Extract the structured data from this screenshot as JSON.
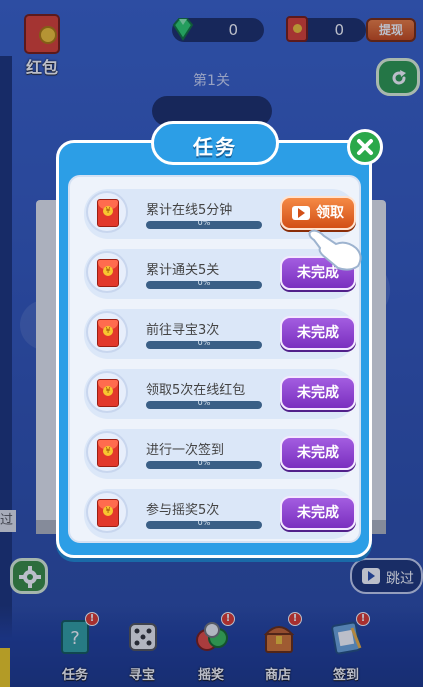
{
  "top_bar": {
    "hongbao_label": "红包",
    "gem_count": "0",
    "hongbao_count": "0",
    "withdraw_label": "提现"
  },
  "stage": {
    "label": "第1关"
  },
  "skip": {
    "label": "跳过"
  },
  "modal": {
    "title": "任务",
    "tasks": [
      {
        "name": "累计在线5分钟",
        "progress_text": "0%",
        "progress": 0,
        "button": "领取",
        "state": "claim"
      },
      {
        "name": "累计通关5关",
        "progress_text": "0%",
        "progress": 0,
        "button": "未完成",
        "state": "incomplete"
      },
      {
        "name": "前往寻宝3次",
        "progress_text": "0%",
        "progress": 0,
        "button": "未完成",
        "state": "incomplete"
      },
      {
        "name": "领取5次在线红包",
        "progress_text": "0%",
        "progress": 0,
        "button": "未完成",
        "state": "incomplete"
      },
      {
        "name": "进行一次签到",
        "progress_text": "0%",
        "progress": 0,
        "button": "未完成",
        "state": "incomplete"
      },
      {
        "name": "参与摇奖5次",
        "progress_text": "0%",
        "progress": 0,
        "button": "未完成",
        "state": "incomplete"
      }
    ]
  },
  "left_cut_text": "过",
  "bottom_nav": [
    {
      "label": "任务",
      "icon": "task-book-icon",
      "badge": "!"
    },
    {
      "label": "寻宝",
      "icon": "dice-icon",
      "badge": ""
    },
    {
      "label": "摇奖",
      "icon": "lottery-balls-icon",
      "badge": "!"
    },
    {
      "label": "商店",
      "icon": "treasure-chest-icon",
      "badge": "!"
    },
    {
      "label": "签到",
      "icon": "calendar-sign-icon",
      "badge": "!"
    }
  ],
  "colors": {
    "modal_blue": "#2c9ee6",
    "incomplete_purple": "#7a2fbf",
    "claim_orange": "#d24f17",
    "close_green": "#2aa84a"
  }
}
